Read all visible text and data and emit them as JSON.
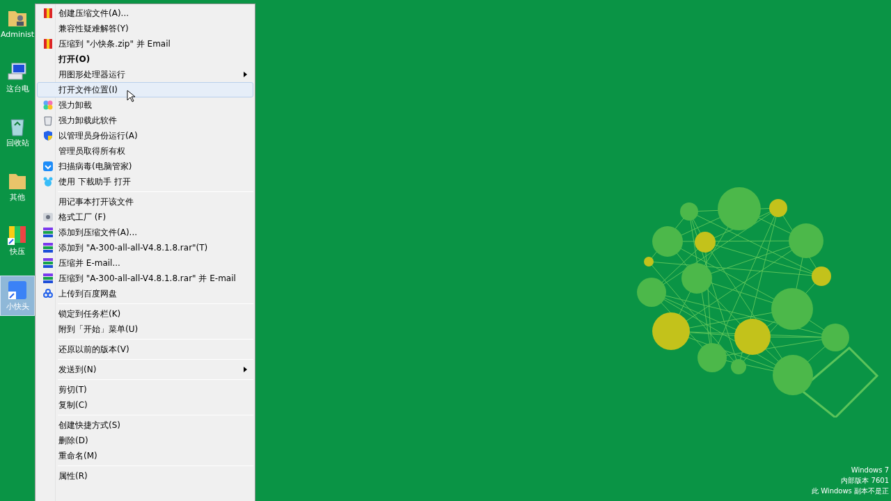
{
  "desktop_icons": [
    {
      "label": "Administ",
      "selected": false
    },
    {
      "label": "这台电",
      "selected": false
    },
    {
      "label": "回收站",
      "selected": false
    },
    {
      "label": "其他",
      "selected": false
    },
    {
      "label": "快压",
      "selected": false
    },
    {
      "label": "小快头",
      "selected": true
    }
  ],
  "context_menu": [
    {
      "kind": "item",
      "label": "创建压缩文件(A)...",
      "bold": false,
      "submenu": false,
      "selected": false
    },
    {
      "kind": "item",
      "label": "兼容性疑难解答(Y)",
      "bold": false,
      "submenu": false,
      "selected": false
    },
    {
      "kind": "item",
      "label": "压缩到 \"小快条.zip\" 并 Email",
      "bold": false,
      "submenu": false,
      "selected": false
    },
    {
      "kind": "item",
      "label": "打开(O)",
      "bold": true,
      "submenu": false,
      "selected": false
    },
    {
      "kind": "item",
      "label": "用图形处理器运行",
      "bold": false,
      "submenu": true,
      "selected": false
    },
    {
      "kind": "item",
      "label": "打开文件位置(I)",
      "bold": false,
      "submenu": false,
      "selected": true
    },
    {
      "kind": "item",
      "label": "强力卸載",
      "bold": false,
      "submenu": false,
      "selected": false
    },
    {
      "kind": "item",
      "label": "强力卸载此软件",
      "bold": false,
      "submenu": false,
      "selected": false
    },
    {
      "kind": "item",
      "label": "以管理员身份运行(A)",
      "bold": false,
      "submenu": false,
      "selected": false
    },
    {
      "kind": "item",
      "label": "管理员取得所有权",
      "bold": false,
      "submenu": false,
      "selected": false
    },
    {
      "kind": "item",
      "label": "扫描病毒(电脑管家)",
      "bold": false,
      "submenu": false,
      "selected": false
    },
    {
      "kind": "item",
      "label": "使用 下載助手 打开",
      "bold": false,
      "submenu": false,
      "selected": false
    },
    {
      "kind": "separator"
    },
    {
      "kind": "item",
      "label": "用记事本打开该文件",
      "bold": false,
      "submenu": false,
      "selected": false
    },
    {
      "kind": "item",
      "label": "格式工厂 (F)",
      "bold": false,
      "submenu": false,
      "selected": false
    },
    {
      "kind": "item",
      "label": "添加到压缩文件(A)...",
      "bold": false,
      "submenu": false,
      "selected": false
    },
    {
      "kind": "item",
      "label": "添加到 \"A-300-all-all-V4.8.1.8.rar\"(T)",
      "bold": false,
      "submenu": false,
      "selected": false
    },
    {
      "kind": "item",
      "label": "压缩并 E-mail...",
      "bold": false,
      "submenu": false,
      "selected": false
    },
    {
      "kind": "item",
      "label": "压缩到 \"A-300-all-all-V4.8.1.8.rar\" 并 E-mail",
      "bold": false,
      "submenu": false,
      "selected": false
    },
    {
      "kind": "item",
      "label": "上传到百度网盘",
      "bold": false,
      "submenu": false,
      "selected": false
    },
    {
      "kind": "separator"
    },
    {
      "kind": "item",
      "label": "锁定到任务栏(K)",
      "bold": false,
      "submenu": false,
      "selected": false
    },
    {
      "kind": "item",
      "label": "附到「开始」菜单(U)",
      "bold": false,
      "submenu": false,
      "selected": false
    },
    {
      "kind": "separator"
    },
    {
      "kind": "item",
      "label": "还原以前的版本(V)",
      "bold": false,
      "submenu": false,
      "selected": false
    },
    {
      "kind": "separator"
    },
    {
      "kind": "item",
      "label": "发送到(N)",
      "bold": false,
      "submenu": true,
      "selected": false
    },
    {
      "kind": "separator"
    },
    {
      "kind": "item",
      "label": "剪切(T)",
      "bold": false,
      "submenu": false,
      "selected": false
    },
    {
      "kind": "item",
      "label": "复制(C)",
      "bold": false,
      "submenu": false,
      "selected": false
    },
    {
      "kind": "separator"
    },
    {
      "kind": "item",
      "label": "创建快捷方式(S)",
      "bold": false,
      "submenu": false,
      "selected": false
    },
    {
      "kind": "item",
      "label": "删除(D)",
      "bold": false,
      "submenu": false,
      "selected": false
    },
    {
      "kind": "item",
      "label": "重命名(M)",
      "bold": false,
      "submenu": false,
      "selected": false
    },
    {
      "kind": "separator"
    },
    {
      "kind": "item",
      "label": "属性(R)",
      "bold": false,
      "submenu": false,
      "selected": false
    }
  ],
  "os_notice": [
    "Windows 7",
    "内部版本 7601",
    "此 Windows 副本不是正"
  ]
}
